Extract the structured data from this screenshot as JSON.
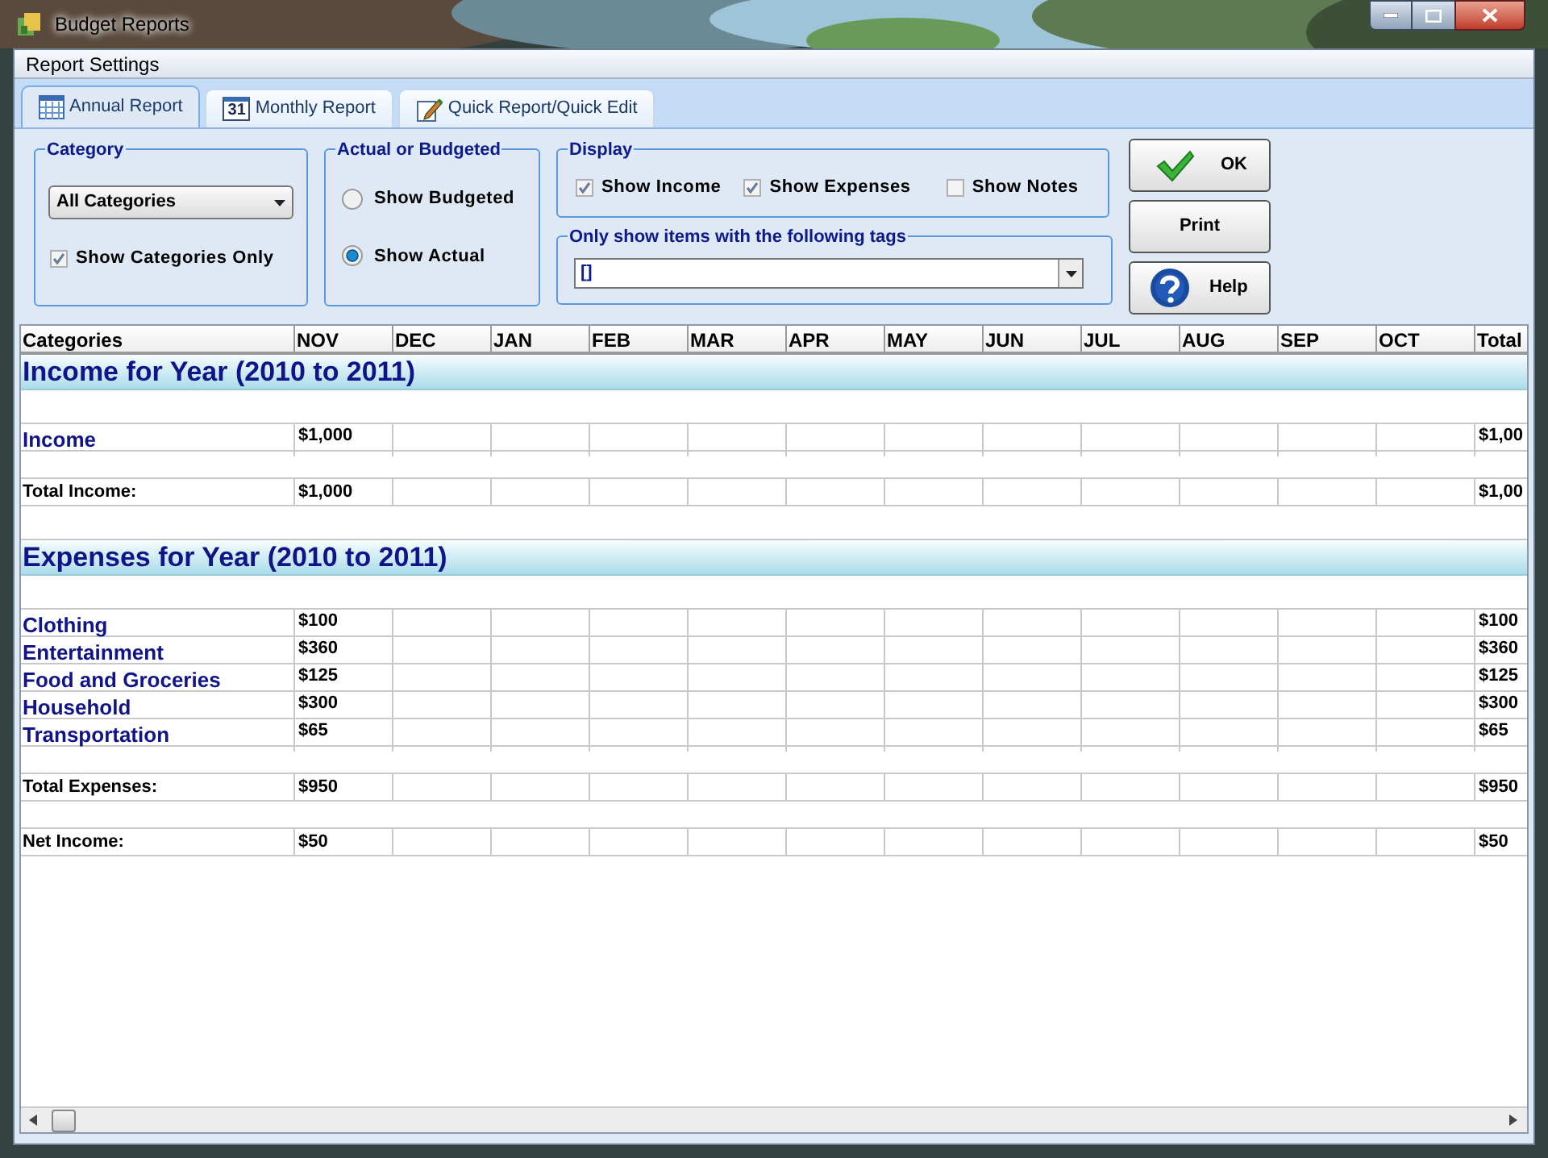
{
  "window": {
    "title": "Budget Reports"
  },
  "menu": [
    "Report Settings"
  ],
  "tabs": [
    {
      "label": "Annual Report",
      "selected": true
    },
    {
      "label": "Monthly Report",
      "selected": false,
      "calendar_day": "31"
    },
    {
      "label": "Quick Report/Quick Edit",
      "selected": false
    }
  ],
  "category": {
    "legend": "Category",
    "dropdown": "All Categories",
    "show_categories_only": {
      "label": "Show Categories Only",
      "checked": true
    }
  },
  "actual_or_budgeted": {
    "legend": "Actual or Budgeted",
    "options": [
      {
        "label": "Show Budgeted",
        "selected": false
      },
      {
        "label": "Show Actual",
        "selected": true
      }
    ]
  },
  "display": {
    "legend": "Display",
    "options": [
      {
        "label": "Show Income",
        "checked": true
      },
      {
        "label": "Show Expenses",
        "checked": true
      },
      {
        "label": "Show Notes",
        "checked": false
      }
    ]
  },
  "tags": {
    "legend": "Only show items with the following tags",
    "value": "[]"
  },
  "buttons": [
    {
      "label": "OK"
    },
    {
      "label": "Print"
    },
    {
      "label": "Help"
    }
  ],
  "table": {
    "columns": [
      "Categories",
      "NOV",
      "DEC",
      "JAN",
      "FEB",
      "MAR",
      "APR",
      "MAY",
      "JUN",
      "JUL",
      "AUG",
      "SEP",
      "OCT",
      "Total"
    ],
    "rows": [
      {
        "kind": "section",
        "label": "Income for Year (2010 to 2011)"
      },
      {
        "kind": "category",
        "label": "Income",
        "nov": "$1,000",
        "total": "$1,00"
      },
      {
        "kind": "total",
        "label": "Total Income:",
        "nov": "$1,000",
        "total": "$1,00"
      },
      {
        "kind": "section",
        "label": "Expenses for Year (2010 to 2011)"
      },
      {
        "kind": "category",
        "label": "Clothing",
        "nov": "$100",
        "total": "$100"
      },
      {
        "kind": "category",
        "label": "Entertainment",
        "nov": "$360",
        "total": "$360"
      },
      {
        "kind": "category",
        "label": "Food and Groceries",
        "nov": "$125",
        "total": "$125"
      },
      {
        "kind": "category",
        "label": "Household",
        "nov": "$300",
        "total": "$300"
      },
      {
        "kind": "category",
        "label": "Transportation",
        "nov": "$65",
        "total": "$65"
      },
      {
        "kind": "total",
        "label": "Total Expenses:",
        "nov": "$950",
        "total": "$950"
      },
      {
        "kind": "total",
        "label": "Net Income:",
        "nov": "$50",
        "total": "$50"
      }
    ]
  }
}
